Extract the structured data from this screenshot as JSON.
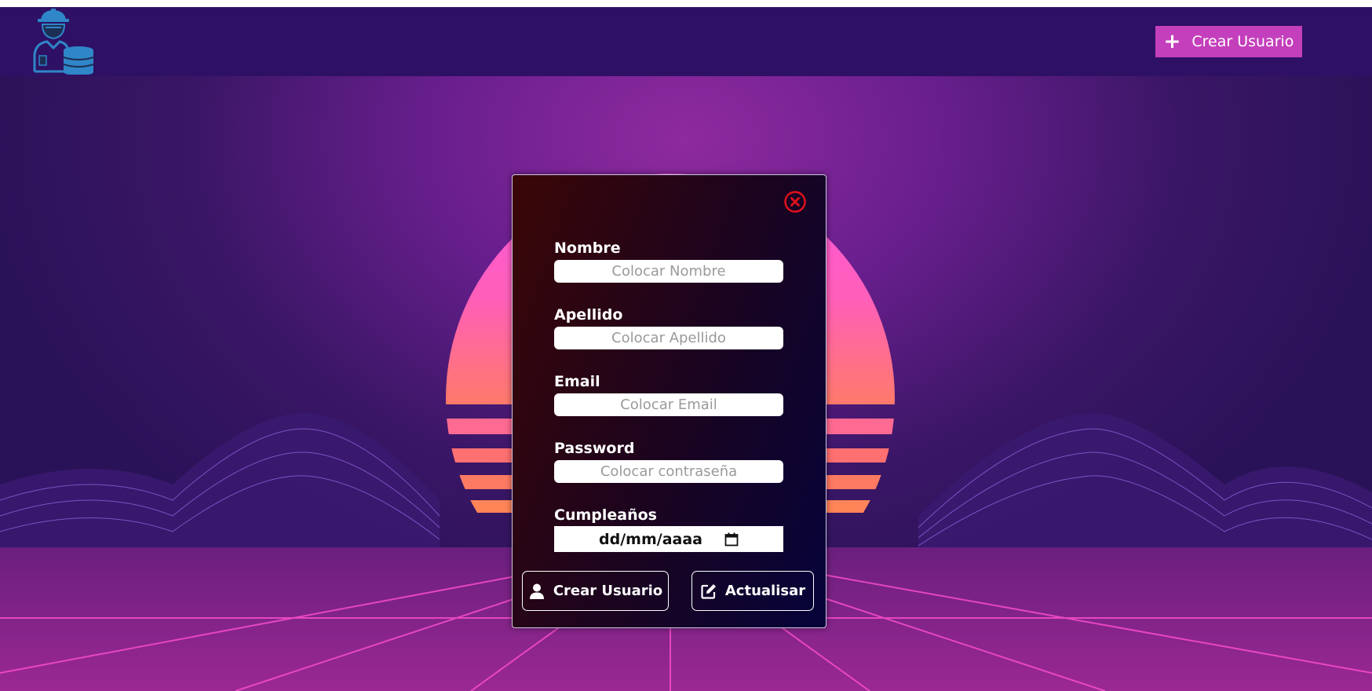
{
  "header": {
    "logo_icon": "worker-database-logo-icon",
    "create_button_label": "Crear Usuario",
    "create_button_icon": "plus-icon",
    "create_button_color": "#c43fbc",
    "background_color": "#2e1164"
  },
  "modal": {
    "close_icon": "close-circle-icon",
    "close_icon_color": "#e0101a",
    "fields": [
      {
        "label": "Nombre",
        "placeholder": "Colocar Nombre"
      },
      {
        "label": "Apellido",
        "placeholder": "Colocar Apellido"
      },
      {
        "label": "Email",
        "placeholder": "Colocar Email"
      },
      {
        "label": "Password",
        "placeholder": "Colocar contraseña"
      }
    ],
    "birthday": {
      "label": "Cumpleaños",
      "value": "dd/mm/aaaa",
      "icon": "calendar-icon"
    },
    "buttons": {
      "create_label": "Crear Usuario",
      "create_icon": "user-icon",
      "update_label": "Actualisar",
      "update_icon": "edit-icon"
    }
  }
}
